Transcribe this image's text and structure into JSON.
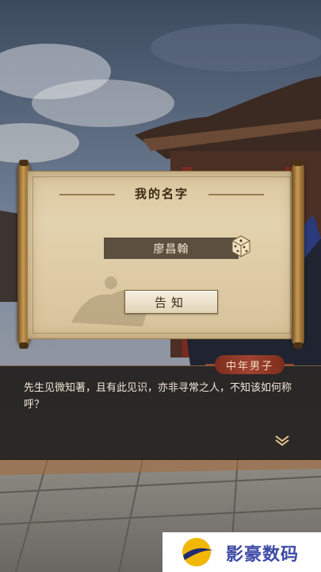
{
  "dialog_box": {
    "title": "我的名字",
    "name_value": "廖昌翰",
    "confirm_label": "告知"
  },
  "speech": {
    "speaker": "中年男子",
    "text": "先生见微知著，且有此见识，亦非寻常之人，不知该如何称呼？"
  },
  "icons": {
    "randomize": "dice-icon",
    "continue": "chevron-down-double-icon"
  },
  "watermark": {
    "text": "影豪数码"
  },
  "colors": {
    "accent": "#a04330",
    "scroll_paper": "#e3d2ae",
    "name_field": "#5b4f40",
    "watermark": "#3d4aa6"
  }
}
